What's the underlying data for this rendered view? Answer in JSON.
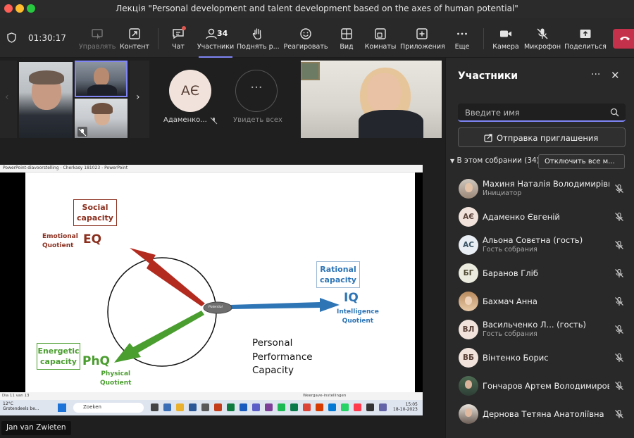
{
  "window": {
    "title": "Лекція \"Personal development and talent development based on the axes of human potential\""
  },
  "toolbar": {
    "timer": "01:30:17",
    "items": [
      {
        "label": "Управлять",
        "icon": "share-control-icon",
        "enabled": false
      },
      {
        "label": "Контент",
        "icon": "share-content-icon",
        "enabled": true
      },
      {
        "label": "Чат",
        "icon": "chat-icon",
        "enabled": true
      },
      {
        "label": "Участники",
        "icon": "people-icon",
        "enabled": true,
        "count": "34"
      },
      {
        "label": "Поднять р...",
        "icon": "raise-hand-icon",
        "enabled": true
      },
      {
        "label": "Реагировать",
        "icon": "smile-icon",
        "enabled": true
      },
      {
        "label": "Вид",
        "icon": "grid-view-icon",
        "enabled": true
      },
      {
        "label": "Комнаты",
        "icon": "breakout-rooms-icon",
        "enabled": true
      },
      {
        "label": "Приложения",
        "icon": "apps-plus-icon",
        "enabled": true
      },
      {
        "label": "Еще",
        "icon": "more-icon",
        "enabled": true
      },
      {
        "label": "Камера",
        "icon": "camera-icon",
        "enabled": true
      },
      {
        "label": "Микрофон",
        "icon": "mic-off-icon",
        "enabled": true
      },
      {
        "label": "Поделиться",
        "icon": "share-tray-icon",
        "enabled": true
      }
    ]
  },
  "gallery": {
    "avatar_initials": "АЄ",
    "avatar_name": "Адаменко...",
    "see_all": "Увидеть всех"
  },
  "presentation": {
    "window_title": "PowerPoint-diavoorstelling  -  Cherkasy 181023  -  PowerPoint",
    "status_left": "Dia 11 van 13",
    "status_right": "Weergave-instellingen",
    "taskbar_weather": "12°C",
    "taskbar_weather_sub": "Grotendeels be...",
    "taskbar_search": "Zoeken",
    "taskbar_time": "15:05",
    "taskbar_date": "18-10-2023",
    "presenter_name": "Jan van Zwieten",
    "slide": {
      "social_capacity": [
        "Social",
        "capacity"
      ],
      "emotional_quotient": [
        "Emotional",
        "Quotient"
      ],
      "eq": "EQ",
      "rational_capacity": [
        "Rational",
        "capacity"
      ],
      "iq": "IQ",
      "intelligence_quotient": [
        "Intelligence",
        "Quotient"
      ],
      "energetic_capacity": [
        "Energetic",
        "capacity"
      ],
      "phq": "PhQ",
      "physical_quotient": [
        "Physical",
        "Quotient"
      ],
      "personal_performance_capacity": [
        "Personal",
        "Performance",
        "Capacity"
      ],
      "potential": "Potential",
      "colors": {
        "eq": "#8b2f1e",
        "iq": "#2e75b6",
        "phq": "#4a9d2f"
      }
    }
  },
  "participants_panel": {
    "title": "Участники",
    "search_placeholder": "Введите имя",
    "invite_label": "Отправка приглашения",
    "section_label": "В этом собрании (34)",
    "mute_all_label": "Отключить все м...",
    "participants": [
      {
        "name": "Махиня Наталія Володимирівна",
        "role": "Инициатор",
        "initials": "",
        "photo": true
      },
      {
        "name": "Адаменко Євгеній",
        "role": "",
        "initials": "АЄ",
        "photo": false
      },
      {
        "name": "Альона Совєтна (гость)",
        "role": "Гость собрания",
        "initials": "АС",
        "photo": false
      },
      {
        "name": "Баранов Гліб",
        "role": "",
        "initials": "БГ",
        "photo": false
      },
      {
        "name": "Бахмач Анна",
        "role": "",
        "initials": "",
        "photo": true
      },
      {
        "name": "Васильченко Л... (гость)",
        "role": "Гость собрания",
        "initials": "ВЛ",
        "photo": false
      },
      {
        "name": "Вінтенко Борис",
        "role": "",
        "initials": "ВБ",
        "photo": false
      },
      {
        "name": "Гончаров Артем Володимирович",
        "role": "",
        "initials": "",
        "photo": true
      },
      {
        "name": "Дернова Тетяна Анатоліївна",
        "role": "",
        "initials": "",
        "photo": true
      }
    ]
  }
}
